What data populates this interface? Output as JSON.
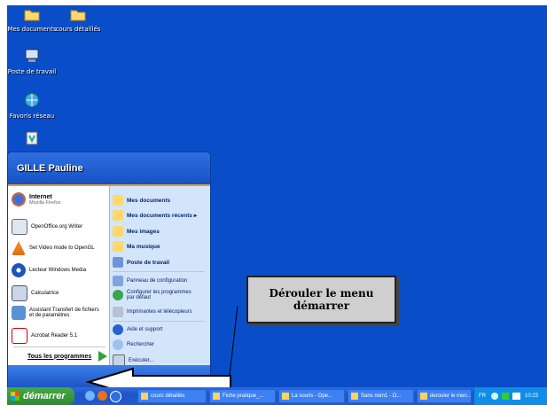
{
  "desktop": {
    "icons": [
      {
        "label": "Mes documents",
        "icon": "folder-icon"
      },
      {
        "label": "cours détaillés",
        "icon": "folder-icon"
      },
      {
        "label": "Poste de travail",
        "icon": "computer-icon"
      },
      {
        "label": "Favoris réseau",
        "icon": "network-icon"
      },
      {
        "label": "",
        "icon": "recycle-bin-icon"
      }
    ]
  },
  "start_menu": {
    "user": "GILLE Pauline",
    "left_items": [
      {
        "title": "Internet",
        "sub": "Mozilla Firefox"
      },
      {
        "title": "OpenOffice.org Writer"
      },
      {
        "title": "Set Video mode to OpenGL"
      },
      {
        "title": "Lecteur Windows Media"
      },
      {
        "title": "Calculatrice"
      },
      {
        "title": "Assistant Transfert de fichiers et de paramètres"
      },
      {
        "title": "Acrobat Reader 5.1"
      }
    ],
    "all_programs": "Tous les programmes",
    "right_items": [
      {
        "label": "Mes documents"
      },
      {
        "label": "Mes documents récents"
      },
      {
        "label": "Mes images"
      },
      {
        "label": "Ma musique"
      },
      {
        "label": "Poste de travail"
      },
      {
        "label": "Panneau de configuration"
      },
      {
        "label": "Configurer les programmes par défaut"
      },
      {
        "label": "Imprimantes et télécopieurs"
      },
      {
        "label": "Aide et support"
      },
      {
        "label": "Rechercher"
      },
      {
        "label": "Exécuter..."
      }
    ]
  },
  "callout": {
    "line1": "Dérouler le menu",
    "line2": "démarrer"
  },
  "taskbar": {
    "start_label": "démarrer",
    "tasks": [
      "cours détaillés",
      "Fiche pratique_...",
      "La souris - Ope...",
      "Sans nom1 - O...",
      "derouler le men..."
    ],
    "tray_lang": "FR",
    "clock": "10:23"
  },
  "colors": {
    "desktop": "#0a4dc8",
    "start_green": "#3a9b3a",
    "taskbar": "#2459cc"
  }
}
